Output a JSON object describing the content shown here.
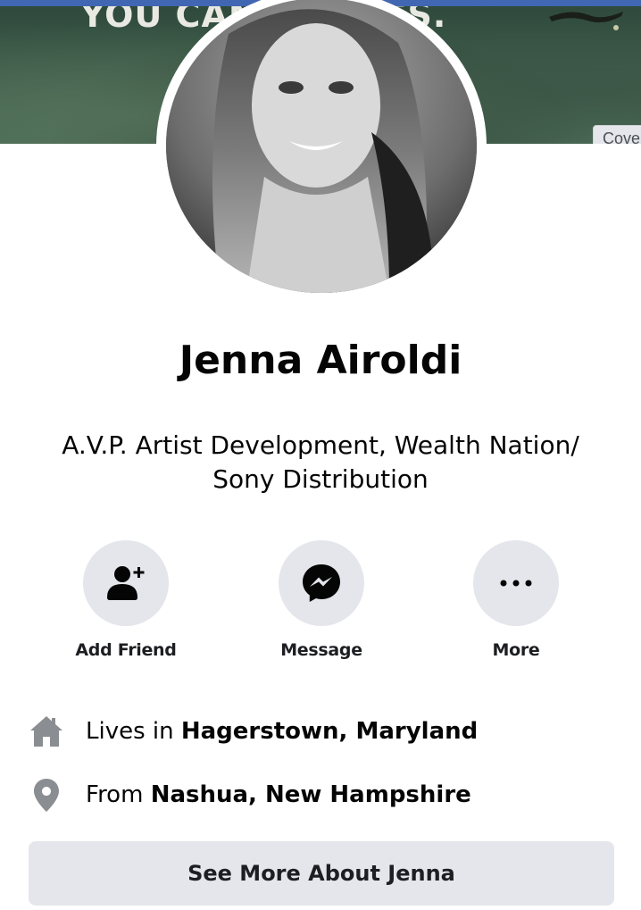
{
  "colors": {
    "brand": "#4267b2",
    "button_bg": "#e4e6eb",
    "icon_gray": "#8a8d91",
    "text_primary": "#050505"
  },
  "cover": {
    "text": "YOU CAN      EYES.",
    "edit_button_label": "Cove"
  },
  "profile": {
    "name": "Jenna Airoldi",
    "bio_line1": "A.V.P. Artist Development, Wealth Nation/",
    "bio_line2": "Sony Distribution"
  },
  "actions": [
    {
      "label": "Add Friend",
      "icon": "add-friend-icon"
    },
    {
      "label": "Message",
      "icon": "messenger-icon"
    },
    {
      "label": "More",
      "icon": "more-icon"
    }
  ],
  "info": {
    "lives_prefix": "Lives in ",
    "lives_value": "Hagerstown, Maryland",
    "from_prefix": "From ",
    "from_value": "Nashua, New Hampshire"
  },
  "see_more_label": "See More About Jenna"
}
